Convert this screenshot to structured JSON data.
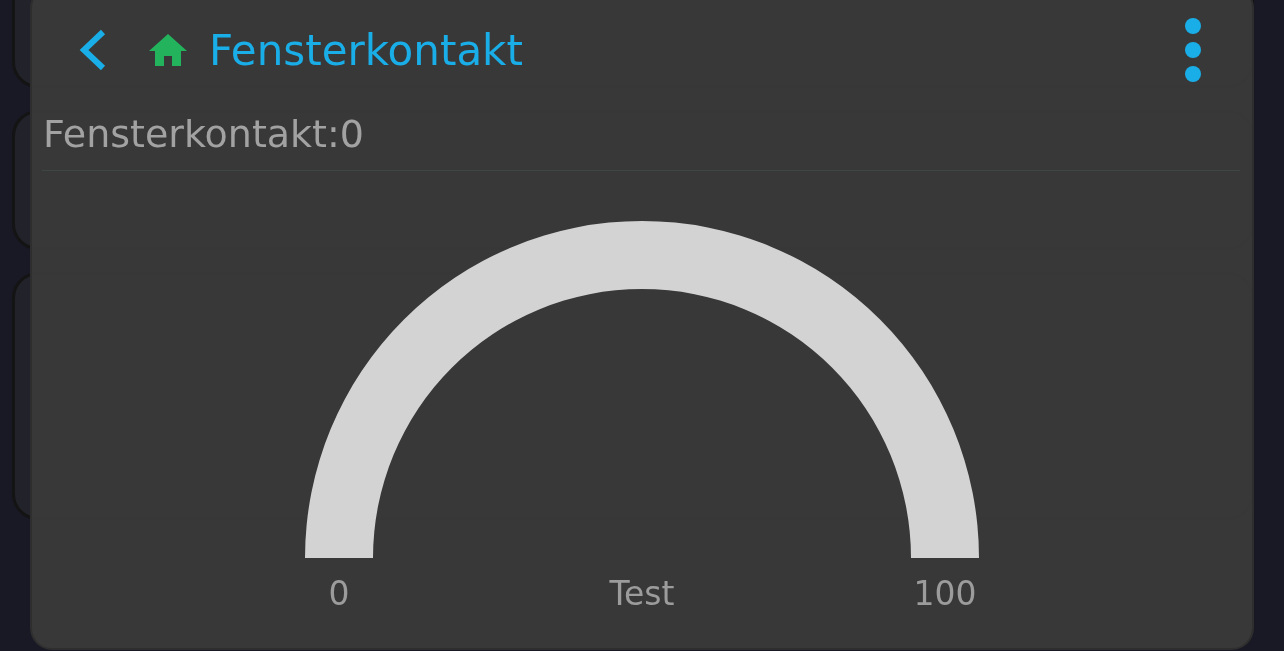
{
  "dialog": {
    "title": "Fensterkontakt",
    "subtitle": "Fensterkontakt:0",
    "gauge": {
      "min": "0",
      "max": "100",
      "label": "Test"
    }
  }
}
